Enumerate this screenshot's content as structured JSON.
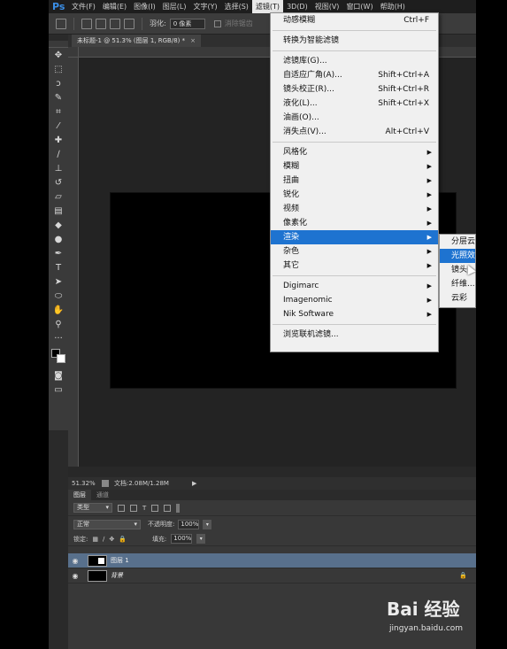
{
  "app": {
    "logo": "Ps"
  },
  "menubar": {
    "items": [
      "文件(F)",
      "编辑(E)",
      "图像(I)",
      "图层(L)",
      "文字(Y)",
      "选择(S)",
      "滤镜(T)",
      "3D(D)",
      "视图(V)",
      "窗口(W)",
      "帮助(H)"
    ],
    "active_index": 6
  },
  "options_bar": {
    "feather_label": "羽化:",
    "feather_value": "0 像素",
    "antialias_label": "消除锯齿"
  },
  "document": {
    "tab_title": "未标题-1 @ 51.3% (图层 1, RGB/8) *",
    "close_glyph": "×",
    "status_zoom": "51.32%",
    "status_doc": "文档:2.08M/1.28M",
    "canvas_color": "#000000"
  },
  "filter_menu": {
    "items": [
      {
        "label": "动感模糊",
        "shortcut": "Ctrl+F"
      },
      {
        "sep": true
      },
      {
        "label": "转换为智能滤镜"
      },
      {
        "sep": true
      },
      {
        "label": "滤镜库(G)..."
      },
      {
        "label": "自适应广角(A)...",
        "shortcut": "Shift+Ctrl+A"
      },
      {
        "label": "镜头校正(R)...",
        "shortcut": "Shift+Ctrl+R"
      },
      {
        "label": "液化(L)...",
        "shortcut": "Shift+Ctrl+X"
      },
      {
        "label": "油画(O)..."
      },
      {
        "label": "消失点(V)...",
        "shortcut": "Alt+Ctrl+V"
      },
      {
        "sep": true
      },
      {
        "label": "风格化",
        "submenu": true
      },
      {
        "label": "模糊",
        "submenu": true
      },
      {
        "label": "扭曲",
        "submenu": true
      },
      {
        "label": "锐化",
        "submenu": true
      },
      {
        "label": "视频",
        "submenu": true
      },
      {
        "label": "像素化",
        "submenu": true
      },
      {
        "label": "渲染",
        "submenu": true,
        "highlighted": true
      },
      {
        "label": "杂色",
        "submenu": true
      },
      {
        "label": "其它",
        "submenu": true
      },
      {
        "sep": true
      },
      {
        "label": "Digimarc",
        "submenu": true
      },
      {
        "label": "Imagenomic",
        "submenu": true
      },
      {
        "label": "Nik Software",
        "submenu": true
      },
      {
        "sep": true
      },
      {
        "label": "浏览联机滤镜..."
      }
    ]
  },
  "render_submenu": {
    "items": [
      {
        "label": "分层云"
      },
      {
        "label": "光照效"
      },
      {
        "label": "镜头"
      },
      {
        "label": "纤维..."
      },
      {
        "label": "云彩"
      }
    ],
    "highlighted_index": 1
  },
  "layers_panel": {
    "tabs": [
      "图层",
      "通道"
    ],
    "filter_kind": "类型",
    "blend_mode": "正常",
    "opacity_label": "不透明度:",
    "opacity_value": "100%",
    "lock_label": "锁定:",
    "fill_label": "填充:",
    "fill_value": "100%",
    "layers": [
      {
        "name": "图层 1",
        "selected": true
      },
      {
        "name": "背景",
        "locked": true
      }
    ]
  },
  "colors": {
    "menu_highlight": "#1e73d0",
    "selected_layer": "#58708c",
    "ps_blue": "#3a8ee6"
  },
  "watermark": {
    "main": "Bai 经验",
    "url": "jingyan.baidu.com"
  }
}
